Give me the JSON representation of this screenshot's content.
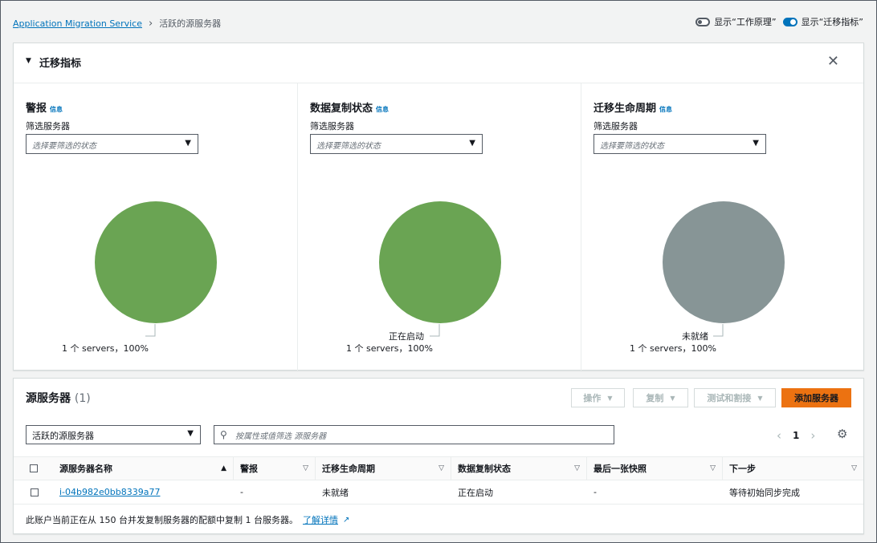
{
  "breadcrumb": {
    "root": "Application Migration Service",
    "current": "活跃的源服务器"
  },
  "toggles": {
    "how_it_works": "显示“工作原理”",
    "migration_metrics": "显示“迁移指标”"
  },
  "metrics": {
    "title": "迁移指标",
    "columns": [
      {
        "title": "警报",
        "info": "信息",
        "filter_label": "筛选服务器",
        "placeholder": "选择要筛选的状态",
        "slice_label": "",
        "count_label": "1 个 servers，100%",
        "color": "#6aa453"
      },
      {
        "title": "数据复制状态",
        "info": "信息",
        "filter_label": "筛选服务器",
        "placeholder": "选择要筛选的状态",
        "slice_label": "正在启动",
        "count_label": "1 个 servers，100%",
        "color": "#6aa453"
      },
      {
        "title": "迁移生命周期",
        "info": "信息",
        "filter_label": "筛选服务器",
        "placeholder": "选择要筛选的状态",
        "slice_label": "未就绪",
        "count_label": "1 个 servers，100%",
        "color": "#879596"
      }
    ]
  },
  "chart_data": [
    {
      "type": "pie",
      "title": "警报",
      "series": [
        {
          "values": [
            1
          ]
        }
      ],
      "percent": [
        100
      ]
    },
    {
      "type": "pie",
      "title": "数据复制状态",
      "categories": [
        "正在启动"
      ],
      "values": [
        1
      ],
      "percent": [
        100
      ]
    },
    {
      "type": "pie",
      "title": "迁移生命周期",
      "categories": [
        "未就绪"
      ],
      "values": [
        1
      ],
      "percent": [
        100
      ]
    }
  ],
  "servers": {
    "title": "源服务器",
    "count": "(1)",
    "buttons": {
      "actions": "操作",
      "replicate": "复制",
      "test_cutover": "测试和割接",
      "add": "添加服务器"
    },
    "type_select": "活跃的源服务器",
    "search_placeholder": "按属性或值筛选 源服务器",
    "page": "1",
    "columns": [
      "源服务器名称",
      "警报",
      "迁移生命周期",
      "数据复制状态",
      "最后一张快照",
      "下一步"
    ],
    "rows": [
      {
        "name": "i-04b982e0bb8339a77",
        "alerts": "-",
        "lifecycle": "未就绪",
        "replication": "正在启动",
        "last_snapshot": "-",
        "next_step": "等待初始同步完成"
      }
    ],
    "footer_text": "此账户当前正在从 150 台并发复制服务器的配额中复制 1 台服务器。",
    "learn_more": "了解详情"
  },
  "icons": {
    "breadcrumb_sep": "chevron-right-icon",
    "close": "close-icon",
    "search": "search-icon",
    "settings": "gear-icon",
    "external": "external-link-icon"
  }
}
